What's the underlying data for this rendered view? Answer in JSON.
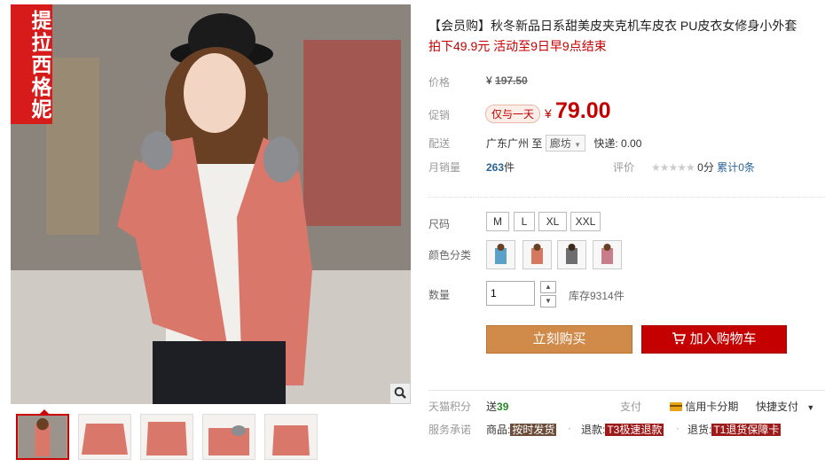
{
  "product": {
    "brand_tag": "提拉西格妮",
    "title": "【会员购】秋冬新品日系甜美皮夹克机车皮衣 PU皮衣女修身小外套",
    "promo": "拍下49.9元 活动至9日早9点结束"
  },
  "price": {
    "label": "价格",
    "currency": "¥",
    "original": "197.50"
  },
  "promotion": {
    "label": "促销",
    "badge": "仅与一天",
    "currency": "¥",
    "price": "79.00"
  },
  "shipping": {
    "label": "配送",
    "from": "广东广州",
    "to_word": "至",
    "destination": "廊坊",
    "express": "快递: 0.00"
  },
  "sales": {
    "label": "月销量",
    "count": "263",
    "unit": "件",
    "rating_label": "评价",
    "stars": "★★★★★",
    "score": "0分",
    "cumulative_label": "累计",
    "cumulative": "0条"
  },
  "size": {
    "label": "尺码",
    "options": [
      "M",
      "L",
      "XL",
      "XXL"
    ]
  },
  "colors": {
    "label": "颜色分类",
    "swatch_colors": [
      "#5aa0c8",
      "#d4785f",
      "#6d6d70",
      "#c87d8a"
    ]
  },
  "quantity": {
    "label": "数量",
    "value": "1",
    "up": "▲",
    "down": "▼",
    "stock": "库存9314件"
  },
  "actions": {
    "buy": "立刻购买",
    "cart": "加入购物车"
  },
  "bottom": {
    "points_label": "天猫积分",
    "points_text": "送",
    "points_value": "39",
    "pay_label": "支付",
    "credit": "信用卡分期",
    "quick_pay": "快捷支付",
    "promise_label": "服务承诺",
    "goods_label": "商品:",
    "goods_tag": "按时发货",
    "refund_label": "退款:",
    "refund_tag": "T3极速退款",
    "return_label": "退货:",
    "return_tag": "T1退货保障卡",
    "dot": "·"
  },
  "colors_theme": {
    "accent_red": "#c40000",
    "buy_orange": "#d08a49"
  }
}
